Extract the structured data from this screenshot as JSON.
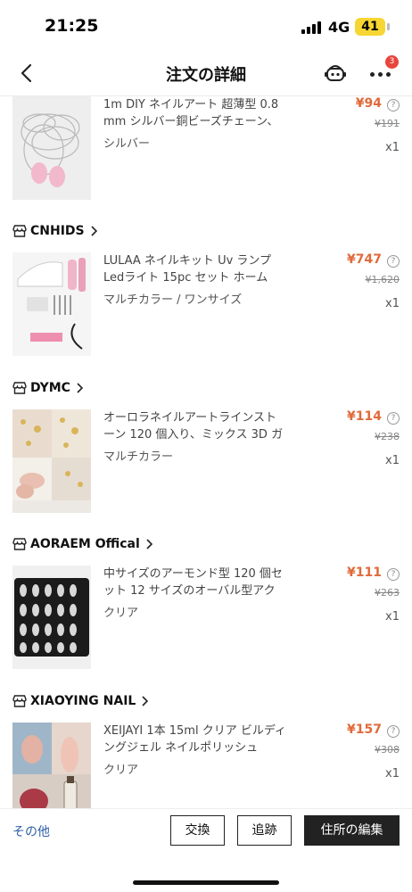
{
  "status_bar": {
    "time": "21:25",
    "network": "4G",
    "battery": "41"
  },
  "header": {
    "title": "注文の詳細",
    "notification_count": "3"
  },
  "stores": [
    {
      "name": "CNHIDS"
    },
    {
      "name": "DYMC"
    },
    {
      "name": "AORAEM Offical"
    },
    {
      "name": "XIAOYING NAIL"
    }
  ],
  "products": [
    {
      "title": "1m DIY ネイルアート 超薄型 0.8 mm シルバー銅ビーズチェーン、",
      "variant": "シルバー",
      "price": "¥94",
      "original_price": "¥191",
      "quantity": "x1"
    },
    {
      "title": "LULAA ネイルキット Uv ランプ Ledライト 15pc セット ホーム",
      "variant": "マルチカラー / ワンサイズ",
      "price": "¥747",
      "original_price": "¥1,620",
      "quantity": "x1"
    },
    {
      "title": "オーロラネイルアートラインストーン 120 個入り、ミックス 3D ガ",
      "variant": "マルチカラー",
      "price": "¥114",
      "original_price": "¥238",
      "quantity": "x1"
    },
    {
      "title": "中サイズのアーモンド型 120 個セット 12 サイズのオーバル型アク",
      "variant": "クリア",
      "price": "¥111",
      "original_price": "¥263",
      "quantity": "x1"
    },
    {
      "title": "XEIJAYI 1本 15ml クリア ビルディングジェル ネイルポリッシュ",
      "variant": "クリア",
      "price": "¥157",
      "original_price": "¥308",
      "quantity": "x1"
    }
  ],
  "footer": {
    "other_label": "その他",
    "exchange_label": "交換",
    "track_label": "追跡",
    "edit_address_label": "住所の編集"
  },
  "colors": {
    "price": "#e06a3a",
    "link": "#2f5fa7",
    "badge": "#e8453c",
    "battery": "#f7d633"
  }
}
